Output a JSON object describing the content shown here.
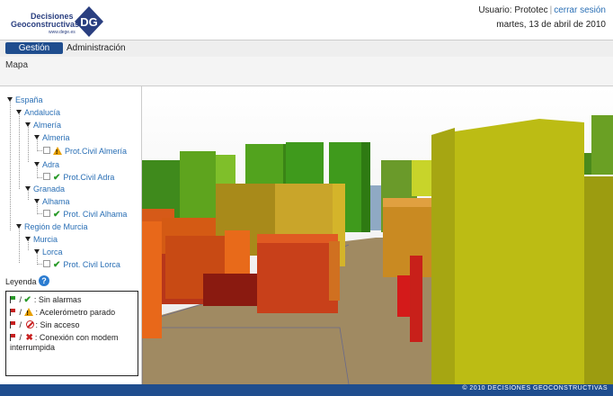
{
  "header": {
    "logo_line1": "Decisiones",
    "logo_line2": "Geoconstructivas",
    "logo_url": "www.dege.es",
    "user_label": "Usuario: Prototec",
    "logout_label": "cerrar sesión",
    "date": "martes, 13 de abril de 2010"
  },
  "tabs": [
    {
      "label": "Gestión",
      "active": true
    },
    {
      "label": "Administración",
      "active": false
    }
  ],
  "breadcrumb": "Mapa",
  "tree": {
    "espana": "España",
    "andalucia": "Andalucía",
    "almeria_prov": "Almería",
    "almeria_city": "Almeria",
    "almeria_station": "Prot.Civil Almería",
    "adra": "Adra",
    "adra_station": "Prot.Civil Adra",
    "granada": "Granada",
    "alhama": "Alhama",
    "alhama_station": "Prot. Civil Alhama",
    "murcia_region": "Región de Murcia",
    "murcia": "Murcia",
    "lorca": "Lorca",
    "lorca_station": "Prot. Civil Lorca"
  },
  "legend": {
    "title": "Leyenda",
    "items": [
      {
        "label": "Sin alarmas",
        "status": "ok",
        "flag": "green"
      },
      {
        "label": "Acelerómetro parado",
        "status": "warning",
        "flag": "red"
      },
      {
        "label": "Sin acceso",
        "status": "no-access",
        "flag": "red"
      },
      {
        "label": "Conexión con modem interrumpida",
        "status": "disconnected",
        "flag": "red"
      }
    ]
  },
  "footer": "© 2010 DECISIONES GEOCONSTRUCTIVAS",
  "colors": {
    "brand_blue": "#1f4d8e",
    "link_blue": "#2a6fb5",
    "ok_green": "#2a9a2a",
    "warning_orange": "#e8a000",
    "alert_red": "#c82020"
  }
}
